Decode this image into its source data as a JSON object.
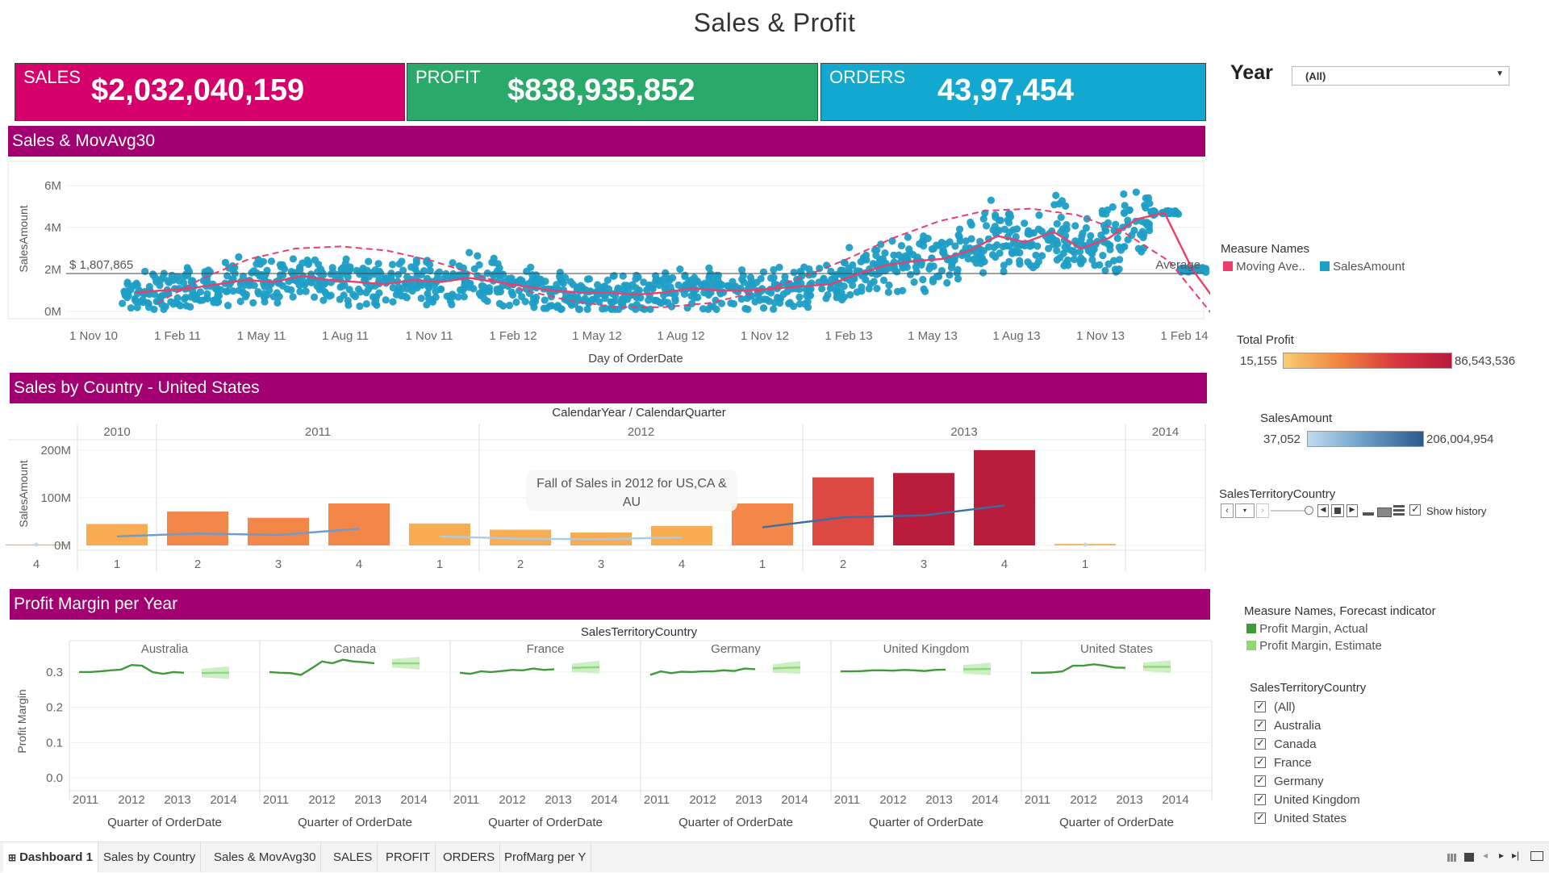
{
  "page": {
    "title": "Sales & Profit"
  },
  "kpis": {
    "sales": {
      "label": "SALES",
      "value": "$2,032,040,159",
      "color": "#d6006b"
    },
    "profit": {
      "label": "PROFIT",
      "value": "$838,935,852",
      "color": "#2aaa6a"
    },
    "orders": {
      "label": "ORDERS",
      "value": "43,97,454",
      "color": "#12a8cf"
    }
  },
  "filters": {
    "year_label": "Year",
    "year_value": "(All)"
  },
  "sections": {
    "movavg": "Sales & MovAvg30",
    "country": "Sales by Country - United States",
    "margin": "Profit Margin per Year"
  },
  "chart_data": [
    {
      "type": "scatter",
      "title": "Sales & MovAvg30",
      "xlabel": "Day of OrderDate",
      "ylabel": "SalesAmount",
      "x_ticks": [
        "1 Nov 10",
        "1 Feb 11",
        "1 May 11",
        "1 Aug 11",
        "1 Nov 11",
        "1 Feb 12",
        "1 May 12",
        "1 Aug 12",
        "1 Nov 12",
        "1 Feb 13",
        "1 May 13",
        "1 Aug 13",
        "1 Nov 13",
        "1 Feb 14"
      ],
      "y_ticks": [
        "0M",
        "2M",
        "4M",
        "6M"
      ],
      "ylim": [
        0,
        7000000
      ],
      "reference_line": {
        "label": "Average",
        "value": 1807865,
        "value_label": "$ 1,807,865"
      },
      "series": [
        {
          "name": "SalesAmount",
          "color": "#1f9ec6"
        },
        {
          "name": "Moving Ave..",
          "color": "#ea3f6b"
        }
      ],
      "moving_average_months": [
        0,
        1,
        2,
        3,
        4,
        5,
        6,
        7,
        8,
        9,
        10,
        11,
        12,
        13,
        14,
        15,
        16,
        17,
        18,
        19,
        20,
        21,
        22,
        23,
        24,
        25,
        26,
        27,
        28,
        29,
        30,
        31,
        32,
        33,
        34,
        35,
        36,
        37,
        38,
        39
      ],
      "moving_average_values": [
        0.9,
        1.0,
        1.1,
        1.3,
        1.5,
        1.4,
        1.7,
        1.5,
        1.4,
        1.3,
        1.5,
        1.4,
        1.6,
        1.4,
        1.2,
        1.0,
        0.9,
        0.9,
        0.8,
        0.9,
        1.1,
        1.0,
        1.0,
        1.1,
        1.2,
        1.3,
        1.8,
        2.2,
        2.4,
        2.5,
        2.9,
        3.6,
        3.3,
        3.8,
        3.0,
        3.5,
        4.4,
        4.7,
        2.0,
        0.2
      ],
      "trend_values": [
        0.4,
        1.6,
        2.5,
        3.0,
        3.1,
        2.9,
        2.4,
        1.7,
        1.0,
        0.5,
        0.2,
        0.2,
        0.4,
        0.9,
        1.6,
        2.5,
        3.5,
        4.3,
        4.8,
        4.9,
        4.6,
        3.8,
        2.4,
        -0.3
      ]
    },
    {
      "type": "bar",
      "title": "Sales by Country - United States",
      "header": "CalendarYear / CalendarQuarter",
      "ylabel": "SalesAmount",
      "y_ticks": [
        "0M",
        "100M",
        "200M"
      ],
      "ylim": [
        0,
        210000000
      ],
      "years": [
        "2010",
        "2011",
        "2012",
        "2013",
        "2014"
      ],
      "categories": [
        "4",
        "1",
        "2",
        "3",
        "4",
        "1",
        "2",
        "3",
        "4",
        "1",
        "2",
        "3",
        "4",
        "1"
      ],
      "year_of_category": [
        "2010",
        "2011",
        "2011",
        "2011",
        "2011",
        "2012",
        "2012",
        "2012",
        "2012",
        "2013",
        "2013",
        "2013",
        "2013",
        "2014"
      ],
      "values": [
        2000000,
        45000000,
        71000000,
        58000000,
        88000000,
        46000000,
        33000000,
        27000000,
        41000000,
        88000000,
        143000000,
        152000000,
        200000000,
        3000000
      ],
      "line_values": [
        null,
        19000000,
        25000000,
        22000000,
        35000000,
        19000000,
        14000000,
        13000000,
        17000000,
        38000000,
        59000000,
        63000000,
        84000000,
        null
      ],
      "annotation": "Fall of Sales in 2012 for US,CA & AU",
      "color_legend": {
        "title": "Total Profit",
        "min": "15,155",
        "max": "86,543,536"
      }
    },
    {
      "type": "line",
      "title": "Profit Margin per Year",
      "header": "SalesTerritoryCountry",
      "ylabel": "Profit Margin",
      "xlabel": "Quarter of OrderDate",
      "y_ticks": [
        "0.0",
        "0.1",
        "0.2",
        "0.3"
      ],
      "ylim": [
        0,
        0.38
      ],
      "x_ticks": [
        "2011",
        "2012",
        "2013",
        "2014"
      ],
      "series": [
        {
          "name": "Australia",
          "actual": [
            0.3,
            0.3,
            0.302,
            0.305,
            0.307,
            0.32,
            0.318,
            0.3,
            0.295,
            0.3,
            0.298
          ],
          "estimate": [
            0.297,
            0.298,
            0.298
          ]
        },
        {
          "name": "Canada",
          "actual": [
            0.3,
            0.298,
            0.297,
            0.292,
            0.31,
            0.33,
            0.325,
            0.335,
            0.33,
            0.328,
            0.325
          ],
          "estimate": [
            0.325,
            0.325,
            0.325
          ]
        },
        {
          "name": "France",
          "actual": [
            0.298,
            0.295,
            0.302,
            0.3,
            0.303,
            0.306,
            0.305,
            0.31,
            0.306,
            0.308
          ],
          "estimate": [
            0.312,
            0.313,
            0.314
          ]
        },
        {
          "name": "Germany",
          "actual": [
            0.292,
            0.302,
            0.297,
            0.301,
            0.3,
            0.302,
            0.302,
            0.305,
            0.303,
            0.31,
            0.308
          ],
          "estimate": [
            0.31,
            0.312,
            0.313
          ]
        },
        {
          "name": "United Kingdom",
          "actual": [
            0.302,
            0.302,
            0.303,
            0.305,
            0.305,
            0.304,
            0.306,
            0.305,
            0.303,
            0.306,
            0.307
          ],
          "estimate": [
            0.308,
            0.308,
            0.309
          ]
        },
        {
          "name": "United States",
          "actual": [
            0.298,
            0.298,
            0.299,
            0.302,
            0.318,
            0.318,
            0.322,
            0.318,
            0.313,
            0.312
          ],
          "estimate": [
            0.315,
            0.315,
            0.315
          ]
        }
      ]
    }
  ],
  "legends": {
    "measure_names": {
      "title": "Measure Names",
      "items": [
        {
          "label": "Moving Ave..",
          "color": "#ea3f6b"
        },
        {
          "label": "SalesAmount",
          "color": "#1f9ec6"
        }
      ]
    },
    "total_profit": {
      "title": "Total Profit",
      "min": "15,155",
      "max": "86,543,536"
    },
    "sales_amount": {
      "title": "SalesAmount",
      "min": "37,052",
      "max": "206,004,954"
    },
    "territory_pages": {
      "title": "SalesTerritoryCountry",
      "history_label": "Show history"
    },
    "forecast": {
      "title": "Measure Names, Forecast indicator",
      "items": [
        {
          "label": "Profit Margin, Actual",
          "color": "#3f9a3a"
        },
        {
          "label": "Profit Margin, Estimate",
          "color": "#8ed77a"
        }
      ]
    },
    "territory_filter": {
      "title": "SalesTerritoryCountry",
      "items": [
        "(All)",
        "Australia",
        "Canada",
        "France",
        "Germany",
        "United Kingdom",
        "United States"
      ]
    }
  },
  "tabs": [
    "Dashboard 1",
    "Sales by Country",
    "Sales & MovAvg30",
    "SALES",
    "PROFIT",
    "ORDERS",
    "ProfMarg per Y"
  ]
}
